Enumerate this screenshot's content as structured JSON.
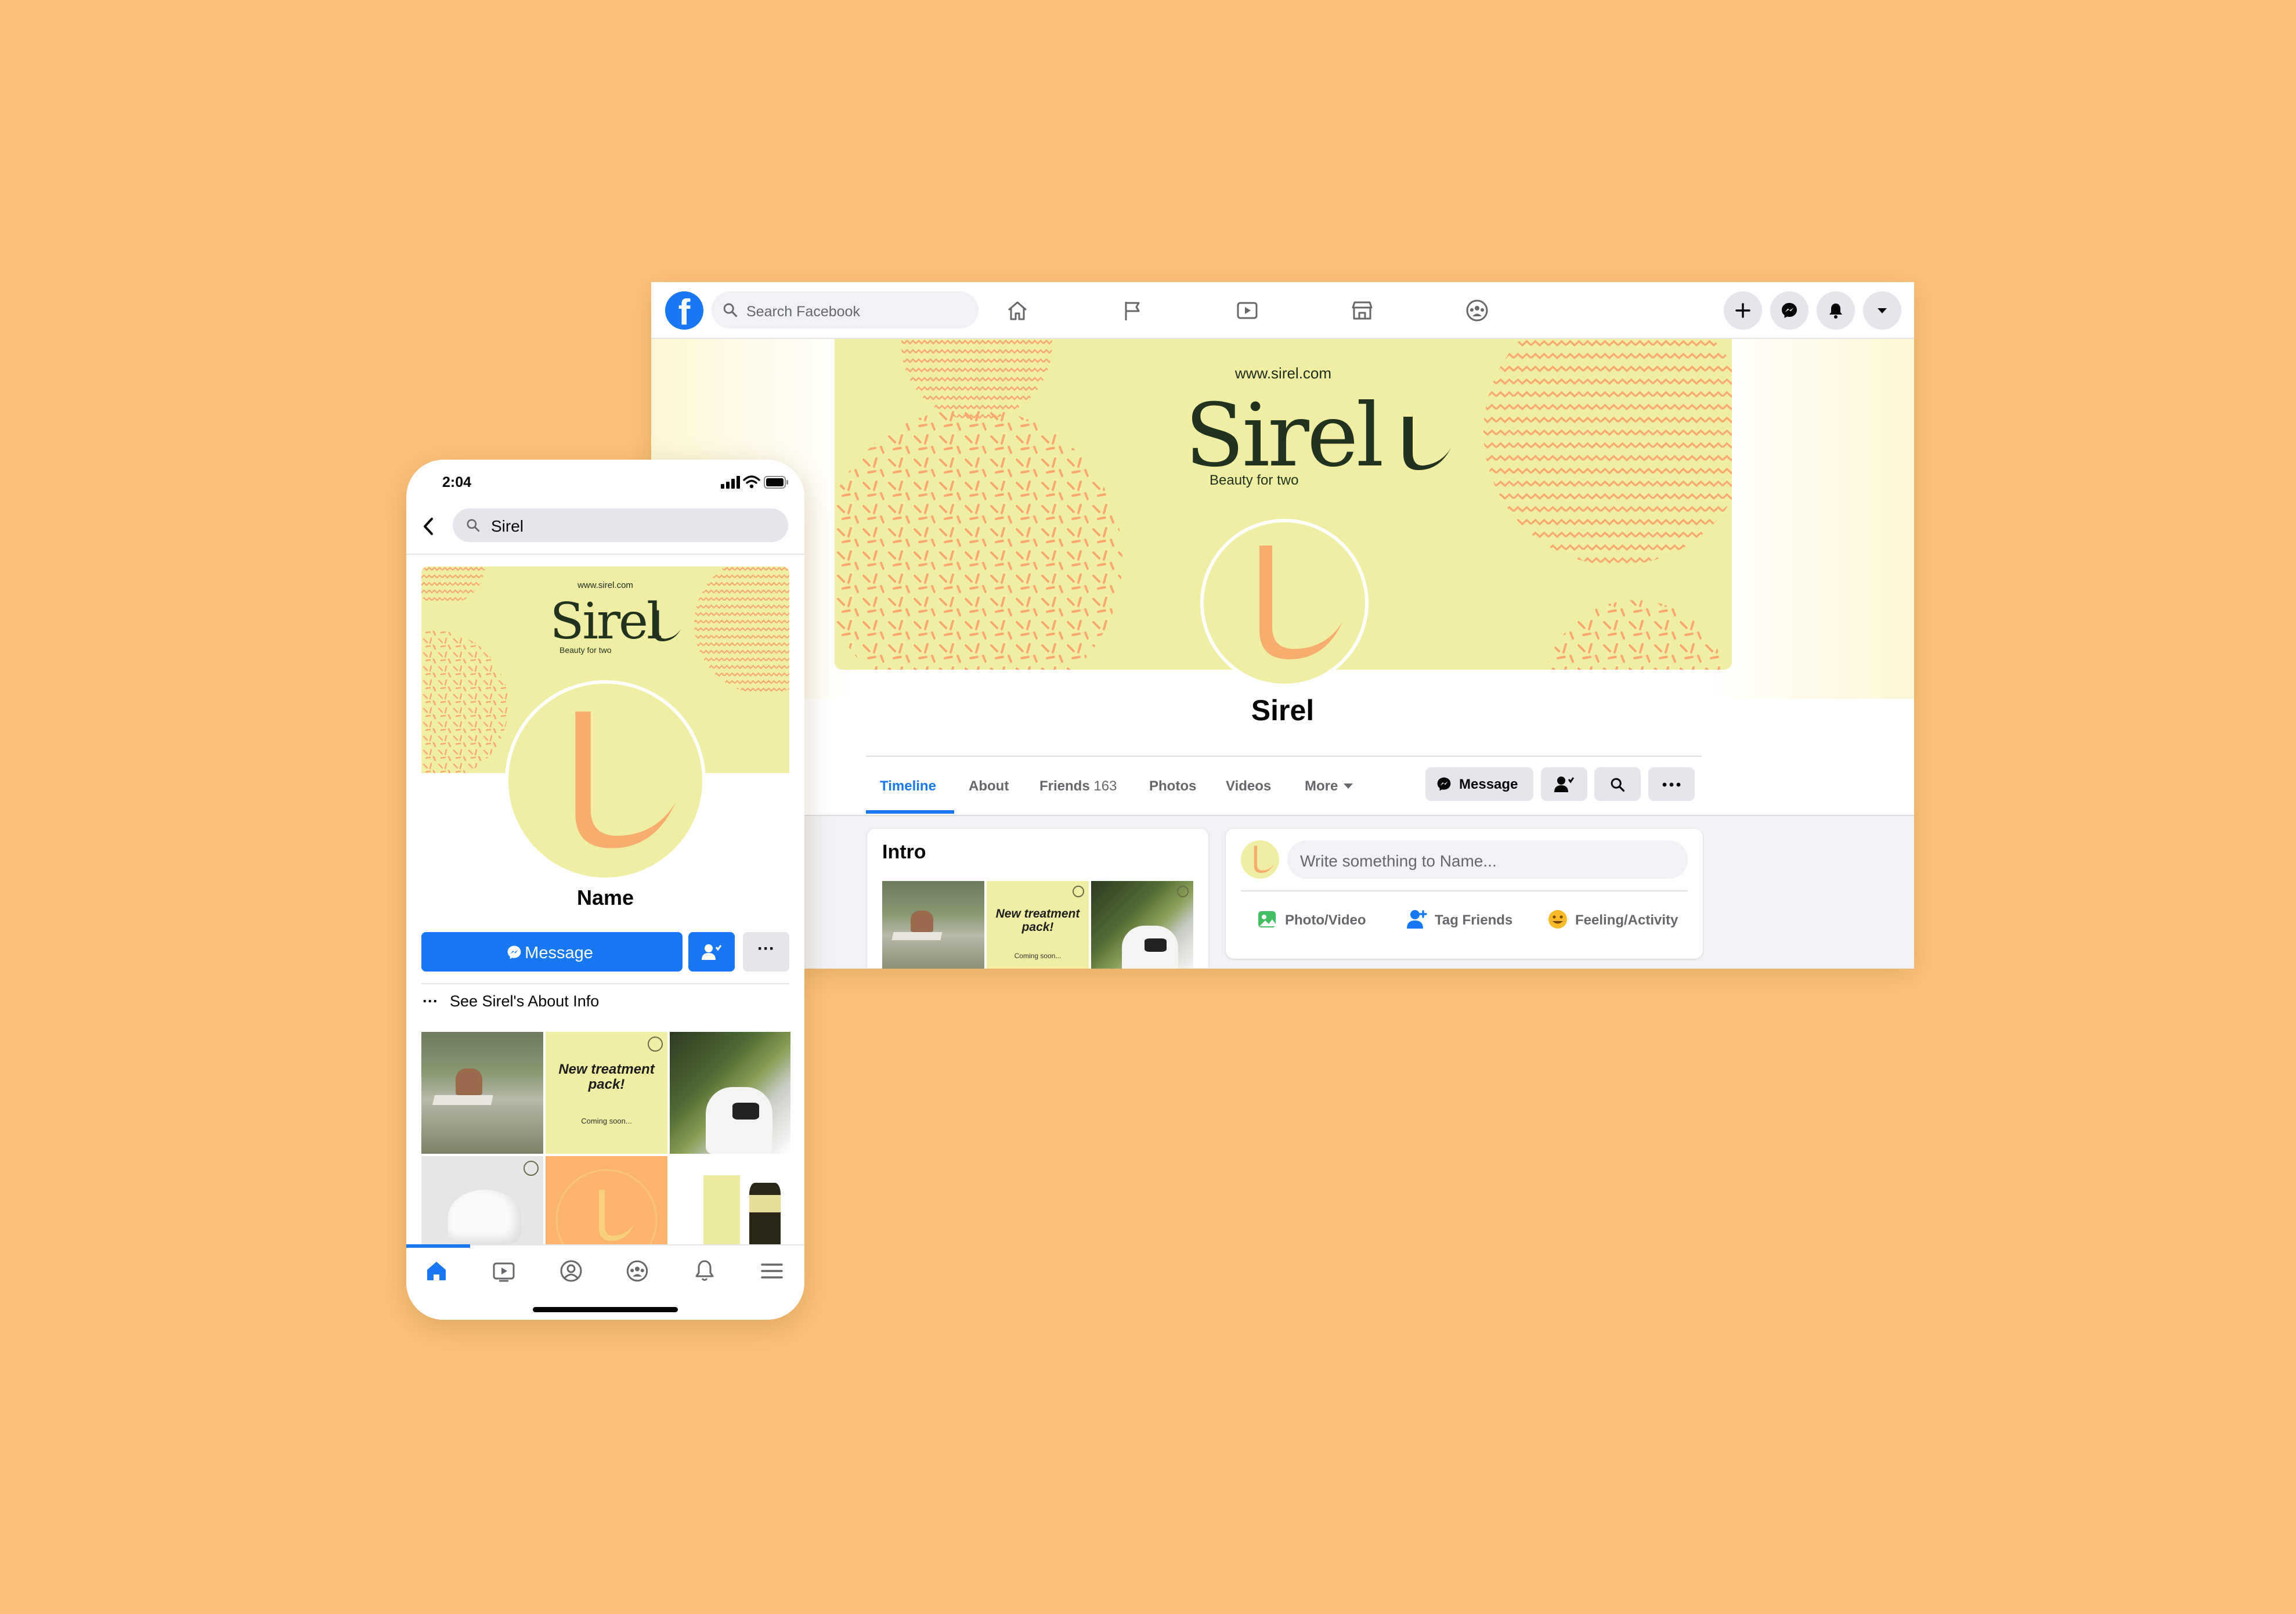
{
  "desktop": {
    "search_placeholder": "Search Facebook",
    "cover": {
      "url": "www.sirel.com",
      "brand": "Sirel",
      "tagline": "Beauty for two"
    },
    "page_name": "Sirel",
    "tabs": [
      {
        "label": "Timeline"
      },
      {
        "label": "About"
      },
      {
        "label": "Friends",
        "count": "163"
      },
      {
        "label": "Photos"
      },
      {
        "label": "Videos"
      },
      {
        "label": "More"
      }
    ],
    "message_label": "Message",
    "intro_title": "Intro",
    "composer_placeholder": "Write something to Name...",
    "post_actions": [
      "Photo/Video",
      "Tag Friends",
      "Feeling/Activity"
    ]
  },
  "mobile": {
    "time": "2:04",
    "search_value": "Sirel",
    "cover": {
      "url": "www.sirel.com",
      "brand": "Sirel",
      "tagline": "Beauty for two"
    },
    "name": "Name",
    "message_label": "Message",
    "more_label": "···",
    "about_link": "See Sirel's About Info",
    "about_dots": "···"
  },
  "promo": {
    "title": "New treatment pack!",
    "subtitle": "Coming soon..."
  },
  "badge_text": "Beauty for two · Sirel ·",
  "colors": {
    "background": "#FCC27B",
    "cover": "#F0EEA4",
    "accent": "#1877F2",
    "brand_text": "#21331F",
    "pattern": "#F9A870"
  }
}
